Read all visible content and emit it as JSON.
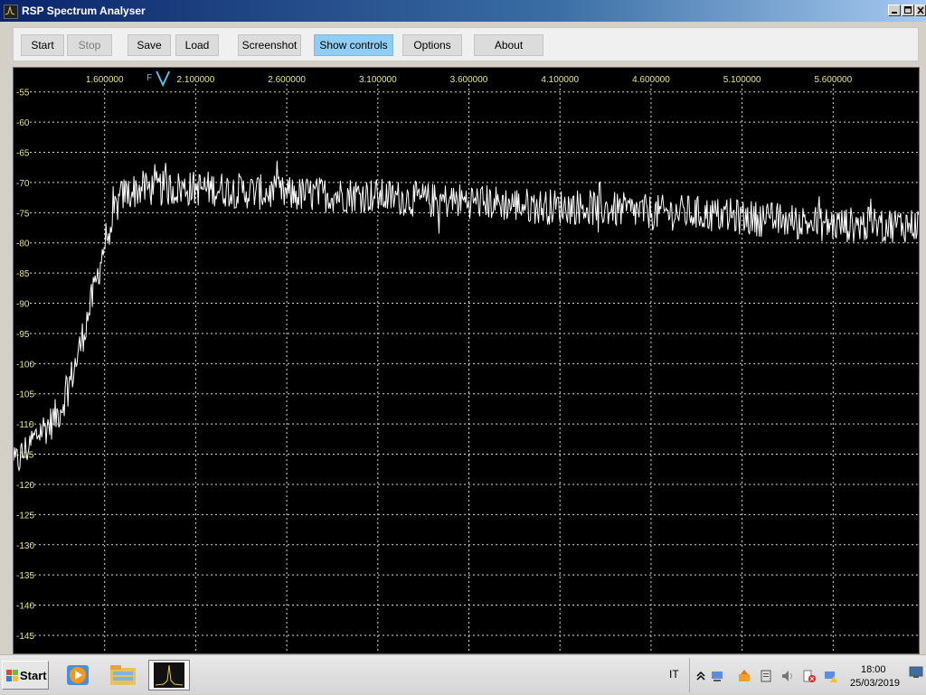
{
  "window": {
    "title": "RSP Spectrum Analyser",
    "min_glyph": "_",
    "max_glyph": "□",
    "close_glyph": "X"
  },
  "toolbar": {
    "start_label": "Start",
    "stop_label": "Stop",
    "save_label": "Save",
    "load_label": "Load",
    "screenshot_label": "Screenshot",
    "show_controls_label": "Show controls",
    "options_label": "Options",
    "about_label": "About",
    "active_color": "#8fcdf5"
  },
  "chart_data": {
    "type": "line",
    "title": "",
    "xlabel": "",
    "ylabel": "",
    "background": "#000000",
    "line_color": "#ffffff",
    "tick_color": "#e6e68a",
    "grid": true,
    "grid_style": "dotted",
    "x_ticks": [
      "1.600000",
      "2.100000",
      "2.600000",
      "3.100000",
      "3.600000",
      "4.100000",
      "4.600000",
      "5.100000",
      "5.600000"
    ],
    "y_ticks": [
      "-55",
      "-60",
      "-65",
      "-70",
      "-75",
      "-80",
      "-85",
      "-90",
      "-95",
      "-100",
      "-105",
      "-110",
      "-115",
      "-120",
      "-125",
      "-130",
      "-135",
      "-140",
      "-145"
    ],
    "xlim": [
      1.1,
      6.07
    ],
    "ylim": [
      -148,
      -51
    ],
    "marker": {
      "label": "F",
      "x": 1.92,
      "color": "#4fc3e8"
    },
    "series": [
      {
        "noise_amplitude": 3,
        "x": [
          1.1,
          1.15,
          1.2,
          1.25,
          1.3,
          1.35,
          1.4,
          1.45,
          1.5,
          1.55,
          1.6,
          1.65,
          1.7,
          1.75,
          1.8,
          1.9,
          2.0,
          2.1,
          2.2,
          2.4,
          2.6,
          2.8,
          3.0,
          3.2,
          3.4,
          3.6,
          3.8,
          4.0,
          4.2,
          4.4,
          4.6,
          4.8,
          5.0,
          5.2,
          5.4,
          5.6,
          5.8,
          6.0,
          6.07
        ],
        "y": [
          -117,
          -115,
          -113,
          -111,
          -110,
          -108,
          -104,
          -99,
          -93,
          -87,
          -80,
          -75,
          -72,
          -71.5,
          -71,
          -71,
          -71,
          -71,
          -71,
          -71.5,
          -72,
          -72,
          -72,
          -72.5,
          -73,
          -73,
          -73.5,
          -74,
          -74,
          -74.5,
          -75,
          -75,
          -75.5,
          -76,
          -76.5,
          -77,
          -77,
          -77,
          -77
        ]
      }
    ]
  },
  "taskbar": {
    "start_label": "Start",
    "language": "IT",
    "time": "18:00",
    "date": "25/03/2019"
  }
}
